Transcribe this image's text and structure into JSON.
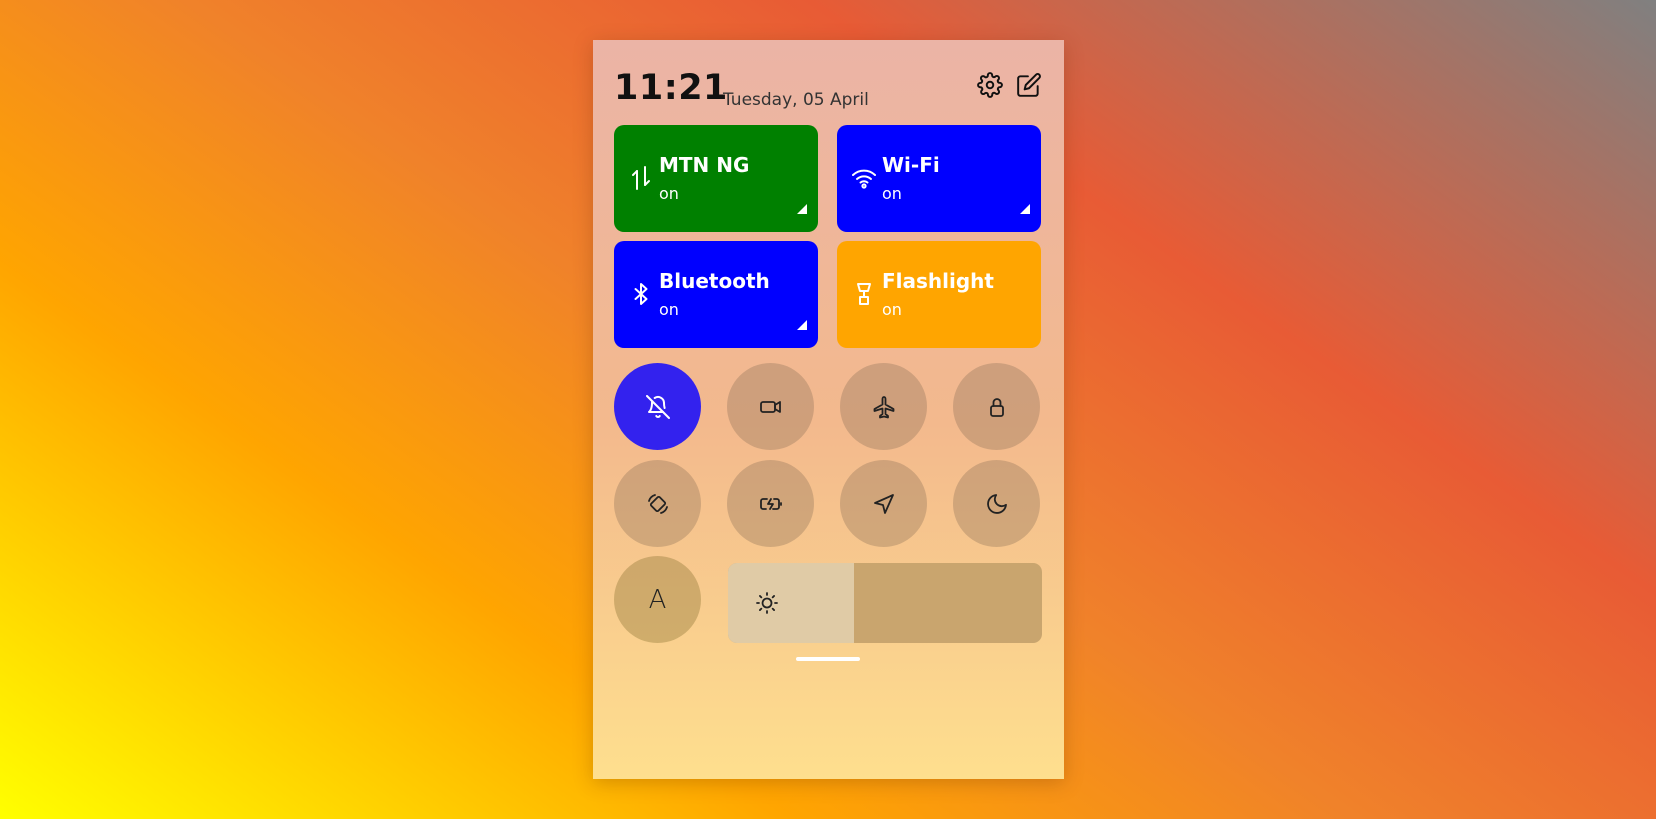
{
  "header": {
    "time": "11:21",
    "date": "Tuesday, 05 April",
    "icons": [
      "gear-icon",
      "edit-icon"
    ]
  },
  "tiles": [
    {
      "label": "MTN NG",
      "status": "on",
      "icon": "mobile-data-icon",
      "color": "#008000",
      "expandable": true
    },
    {
      "label": "Wi-Fi",
      "status": "on",
      "icon": "wifi-icon",
      "color": "#0000ff",
      "expandable": true
    },
    {
      "label": "Bluetooth",
      "status": "on",
      "icon": "bluetooth-icon",
      "color": "#0000ff",
      "expandable": true
    },
    {
      "label": "Flashlight",
      "status": "on",
      "icon": "flashlight-icon",
      "color": "#ffa500",
      "expandable": false
    }
  ],
  "toggles": [
    {
      "icon": "bell-off-icon",
      "active": true,
      "color": "#3322ee"
    },
    {
      "icon": "video-camera-icon",
      "active": false
    },
    {
      "icon": "airplane-icon",
      "active": false
    },
    {
      "icon": "lock-icon",
      "active": false
    },
    {
      "icon": "auto-rotate-icon",
      "active": false
    },
    {
      "icon": "battery-saver-icon",
      "active": false
    },
    {
      "icon": "location-icon",
      "active": false
    },
    {
      "icon": "moon-icon",
      "active": false
    }
  ],
  "font_button": {
    "label": "A"
  },
  "brightness": {
    "level": 0.4,
    "icon": "sun-icon"
  },
  "colors": {
    "inactive_toggle": "rgba(130,105,85,0.32)",
    "panel_top": "#ebb4a6",
    "panel_bottom": "#fedf8e"
  }
}
